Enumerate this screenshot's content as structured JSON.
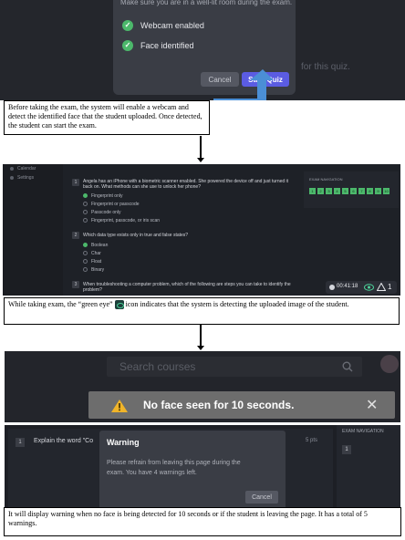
{
  "panel1": {
    "dialog_hint": "Make sure you are in a well-lit room during the exam.",
    "checks": [
      "Webcam enabled",
      "Face identified"
    ],
    "cancel_label": "Cancel",
    "start_label": "Start Quiz",
    "bg_text": "for this quiz.",
    "accent_color": "#5b5ce2",
    "check_color": "#4cb86b"
  },
  "captions": {
    "first": "Before taking the exam, the system will enable a webcam and detect the identified face that the student uploaded. Once detected, the student can start the exam.",
    "second_before": "While taking exam, the “green eye”",
    "second_after": "icon indicates that the system is detecting the uploaded image of the student.",
    "third": "It will display warning when no face is being detected for 10 seconds or if the student is leaving the page. It has a total of 5 warnings."
  },
  "panel2": {
    "sidebar": [
      "Calendar",
      "Settings"
    ],
    "questions": [
      {
        "num": "1",
        "text": "Angela has an iPhone with a biometric scanner enabled. She powered the device off and just turned it back on. What methods can she use to unlock her phone?",
        "options": [
          "Fingerprint only",
          "Fingerprint or passcode",
          "Passcode only",
          "Fingerprint, passcode, or iris scan"
        ],
        "selected": 0
      },
      {
        "num": "2",
        "text": "Which data type exists only in true and false states?",
        "options": [
          "Boolean",
          "Char",
          "Float",
          "Binary"
        ],
        "selected": 0
      },
      {
        "num": "3",
        "text": "When troubleshooting a computer problem, which of the following are steps you can take to identify the problem?",
        "options": [],
        "selected": -1
      }
    ],
    "nav_title": "EXAM NAVIGATION",
    "nav_numbers": [
      "1",
      "2",
      "3",
      "4",
      "5",
      "6",
      "7",
      "8",
      "9",
      "10"
    ],
    "timer": "00:41:18",
    "warning_count": "1"
  },
  "panel3": {
    "search_placeholder": "Search courses",
    "toast_message": "No face seen for 10 seconds.",
    "close_glyph": "✕"
  },
  "panel4": {
    "question_num": "1",
    "question_text": "Explain the word \"Co",
    "points": "5 pts",
    "nav_title": "EXAM NAVIGATION",
    "nav_number": "1",
    "dialog_title": "Warning",
    "dialog_message": "Please refrain from leaving this page during the exam. You have 4 warnings left.",
    "cancel_label": "Cancel"
  }
}
